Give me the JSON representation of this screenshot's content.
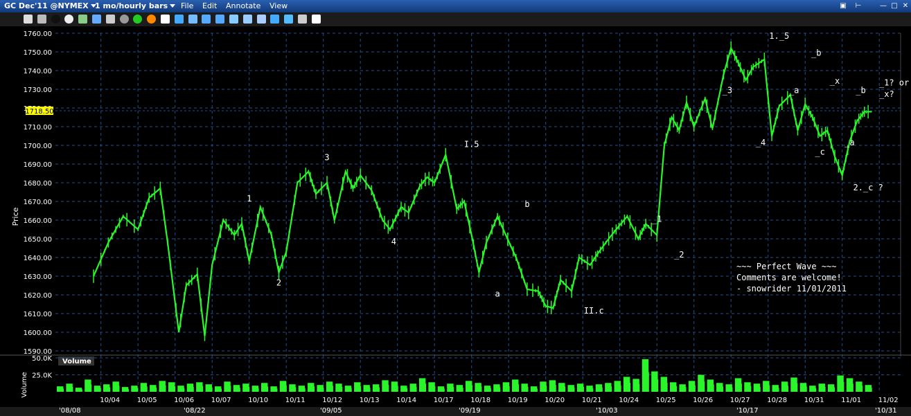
{
  "window": {
    "symbol_label": "GC Dec'11 @NYMEX",
    "timeframe_label": "1 mo/hourly bars",
    "menu": [
      "File",
      "Edit",
      "Annotate",
      "View"
    ]
  },
  "toolbar_icons": [
    "print-icon",
    "grid-icon",
    "circle-black-icon",
    "circle-white-icon",
    "calculator-icon",
    "chart-icon",
    "layout-icon",
    "ball-icon",
    "dollar-icon",
    "target-icon",
    "cursor-icon",
    "text-tool-icon",
    "drawing-icon",
    "undo-icon",
    "redo-icon",
    "fib-icon",
    "channel-icon",
    "line-tool-icon",
    "crosshair-icon",
    "refresh-icon",
    "wrench-icon",
    "dropdown-icon"
  ],
  "colors": {
    "price_line": "#2af52a",
    "volume_bars": "#2af52a",
    "grid": "#1f4f8c",
    "axis_text": "#ffffff",
    "current_price_bg": "#ffff00",
    "annotation_text": "#ffffff",
    "titlebar": "#1d4f9e"
  },
  "chart_data": {
    "type": "line",
    "ylabel": "Price",
    "ylim": [
      1590,
      1760
    ],
    "yticks": [
      "1760.00",
      "1750.00",
      "1740.00",
      "1730.00",
      "1720.00",
      "1710.00",
      "1700.00",
      "1690.00",
      "1680.00",
      "1670.00",
      "1660.00",
      "1650.00",
      "1640.00",
      "1630.00",
      "1620.00",
      "1610.00",
      "1600.00",
      "1590.00"
    ],
    "current_price": {
      "value": 1718.5,
      "label": "1718.50"
    },
    "x_labels": [
      "10/04",
      "10/05",
      "10/06",
      "10/07",
      "10/10",
      "10/11",
      "10/12",
      "10/13",
      "10/14",
      "10/17",
      "10/18",
      "10/19",
      "10/20",
      "10/21",
      "10/24",
      "10/25",
      "10/26",
      "10/27",
      "10/28",
      "10/31",
      "11/01",
      "11/02"
    ],
    "bottom_labels": [
      "'08/08",
      "'08/22",
      "'09/05",
      "'09/19",
      "'10/03",
      "'10/17",
      "'10/31"
    ],
    "series": [
      {
        "x": [
          0,
          0.4,
          0.8,
          1.2,
          1.5,
          1.8,
          2.0,
          2.3,
          2.5,
          2.8,
          3.0,
          3.2,
          3.5,
          3.8,
          4.0,
          4.2,
          4.5,
          4.8,
          5.0,
          5.2,
          5.5,
          5.8,
          6.0,
          6.3,
          6.5,
          6.8,
          7.0,
          7.2,
          7.5,
          7.8,
          8.0,
          8.3,
          8.5,
          8.8,
          9.0,
          9.2,
          9.5,
          9.8,
          10.0,
          10.2,
          10.4,
          10.6,
          10.9,
          11.1,
          11.4,
          11.7,
          12.0,
          12.2,
          12.4,
          12.6,
          12.9,
          13.1,
          13.4,
          13.6,
          13.9,
          14.1,
          14.4,
          14.7,
          14.9,
          15.2,
          15.4,
          15.6,
          15.8,
          16.0,
          16.2,
          16.5,
          16.7,
          17.0,
          17.2,
          17.4,
          17.6,
          17.8,
          18.1,
          18.3,
          18.5,
          18.8,
          19.0,
          19.2,
          19.4,
          19.6,
          19.8,
          20.0,
          20.2,
          20.4,
          20.6,
          20.8,
          21.0
        ],
        "values": [
          1630,
          1648,
          1662,
          1655,
          1672,
          1677,
          1648,
          1600,
          1625,
          1631,
          1598,
          1636,
          1660,
          1652,
          1658,
          1638,
          1667,
          1652,
          1632,
          1643,
          1680,
          1686,
          1674,
          1680,
          1660,
          1686,
          1677,
          1684,
          1676,
          1660,
          1655,
          1667,
          1664,
          1678,
          1683,
          1680,
          1695,
          1666,
          1670,
          1652,
          1632,
          1648,
          1662,
          1653,
          1640,
          1623,
          1622,
          1614,
          1613,
          1628,
          1622,
          1640,
          1636,
          1642,
          1650,
          1655,
          1662,
          1650,
          1658,
          1652,
          1700,
          1715,
          1708,
          1723,
          1710,
          1725,
          1709,
          1738,
          1752,
          1744,
          1735,
          1742,
          1746,
          1705,
          1721,
          1727,
          1708,
          1722,
          1715,
          1705,
          1708,
          1694,
          1684,
          1702,
          1713,
          1718,
          1718
        ]
      }
    ],
    "annotations": [
      {
        "text": "1",
        "x": 4.2,
        "y": 1670
      },
      {
        "text": "2",
        "x": 5.0,
        "y": 1625
      },
      {
        "text": "3",
        "x": 6.3,
        "y": 1692
      },
      {
        "text": "4",
        "x": 8.1,
        "y": 1647
      },
      {
        "text": "I.5",
        "x": 10.2,
        "y": 1699
      },
      {
        "text": "a",
        "x": 10.9,
        "y": 1619
      },
      {
        "text": "b",
        "x": 11.7,
        "y": 1667
      },
      {
        "text": "II.c",
        "x": 13.5,
        "y": 1610
      },
      {
        "text": "_1",
        "x": 15.2,
        "y": 1659
      },
      {
        "text": "_2",
        "x": 15.8,
        "y": 1640
      },
      {
        "text": "_3",
        "x": 17.1,
        "y": 1728
      },
      {
        "text": "_4",
        "x": 18.0,
        "y": 1700
      },
      {
        "text": "1._5",
        "x": 18.5,
        "y": 1757
      },
      {
        "text": "_a",
        "x": 18.9,
        "y": 1728
      },
      {
        "text": "_b",
        "x": 19.5,
        "y": 1748
      },
      {
        "text": "_c",
        "x": 19.6,
        "y": 1695
      },
      {
        "text": "_x",
        "x": 20.0,
        "y": 1733
      },
      {
        "text": "_a",
        "x": 20.4,
        "y": 1700
      },
      {
        "text": "_b",
        "x": 20.7,
        "y": 1728
      },
      {
        "text": "2._c ?",
        "x": 20.9,
        "y": 1676
      },
      {
        "text": "_1? or",
        "x": 21.6,
        "y": 1732
      },
      {
        "text": "_x?",
        "x": 21.4,
        "y": 1726
      }
    ],
    "comment_lines": [
      "~~~ Perfect Wave ~~~",
      "Comments are welcome!",
      "- snowrider  11/01/2011"
    ],
    "volume": {
      "title": "Volume",
      "ylabel": "Volume",
      "yticks": [
        "50.0K",
        "25.0K"
      ],
      "ylim": [
        0,
        50000
      ],
      "values": [
        8000,
        12000,
        6000,
        18000,
        9000,
        11000,
        15000,
        7000,
        9000,
        13000,
        10000,
        16000,
        14000,
        9000,
        12000,
        14000,
        11000,
        8000,
        15000,
        10000,
        12000,
        9000,
        13000,
        8000,
        16000,
        11000,
        9000,
        13000,
        10000,
        15000,
        12000,
        9000,
        14000,
        10000,
        11000,
        17000,
        15000,
        9000,
        12000,
        20000,
        14000,
        8000,
        12000,
        10000,
        16000,
        13000,
        9000,
        11000,
        14000,
        18000,
        12000,
        8000,
        15000,
        17000,
        13000,
        10000,
        12000,
        9000,
        11000,
        13000,
        16000,
        22000,
        19000,
        48000,
        30000,
        22000,
        14000,
        11000,
        16000,
        25000,
        18000,
        13000,
        11000,
        20000,
        14000,
        12000,
        16000,
        10000,
        15000,
        21000,
        13000,
        9000,
        12000,
        11000,
        24000,
        20000,
        15000,
        10000
      ]
    }
  }
}
